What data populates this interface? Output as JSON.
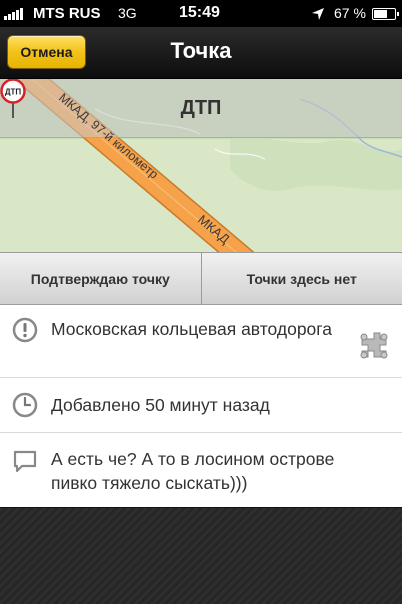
{
  "status_bar": {
    "carrier": "MTS RUS",
    "network": "3G",
    "time": "15:49",
    "battery": "67 %",
    "battery_level": 0.67,
    "icons": [
      "signal-bars-icon",
      "location-arrow-icon",
      "battery-icon"
    ]
  },
  "nav": {
    "cancel_label": "Отмена",
    "title": "Точка"
  },
  "map": {
    "banner": "ДТП",
    "road_label": "МКАД, 97-й километр",
    "road_label_lower": "МКАД",
    "pin_label": "ДТП",
    "colors": {
      "land": "#d9e7c6",
      "road": "#f5a24a",
      "pin": "#d8222a"
    }
  },
  "actions": {
    "confirm_label": "Подтверждаю точку",
    "deny_label": "Точки здесь нет"
  },
  "info": {
    "road": "Московская кольцевая автодорога",
    "added": "Добавлено 50 минут назад",
    "comment": "А есть че? А то в лосином острове пивко тяжело сыскать)))",
    "icons": [
      "exclamation-icon",
      "clock-icon",
      "comment-icon",
      "road-sign-icon"
    ]
  }
}
